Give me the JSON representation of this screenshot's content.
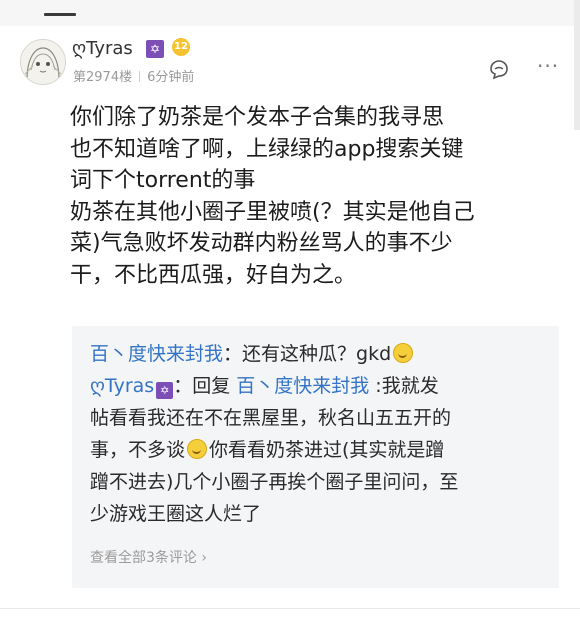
{
  "post": {
    "username": "ღTyras",
    "level": "12",
    "floor": "第2974楼",
    "time": "6分钟前",
    "more": "···",
    "lines": [
      "你们除了奶茶是个发本子合集的我寻思",
      "也不知道啥了啊，上绿绿的app搜索关键",
      "词下个torrent的事",
      "奶茶在其他小圈子里被喷(？其实是他自己",
      "菜)气急败坏发动群内粉丝骂人的事不少",
      "干，不比西瓜强，好自为之。"
    ]
  },
  "replies": {
    "r1_author": "百丶度快来封我",
    "r1_text": "：还有这种瓜？gkd",
    "r2_author": "ღTyras",
    "r2_reply_word": "：回复",
    "r2_target": "百丶度快来封我",
    "r2_line1_text": " :我就发",
    "r2_line2": "帖看看我还在不在黑屋里，秋名山五五开的",
    "r2_line3a": "事，不多谈",
    "r2_line3b": "你看看奶茶进过(其实就是蹭",
    "r2_line4": "蹭不进去)几个小圈子再挨个圈子里问问，至",
    "r2_line5": "少游戏王圈这人烂了",
    "view_all": "查看全部3条评论 ›"
  },
  "colors": {
    "link": "#3474c6",
    "badge_purple": "#7b4fb6",
    "badge_gold": "#f4c430"
  }
}
